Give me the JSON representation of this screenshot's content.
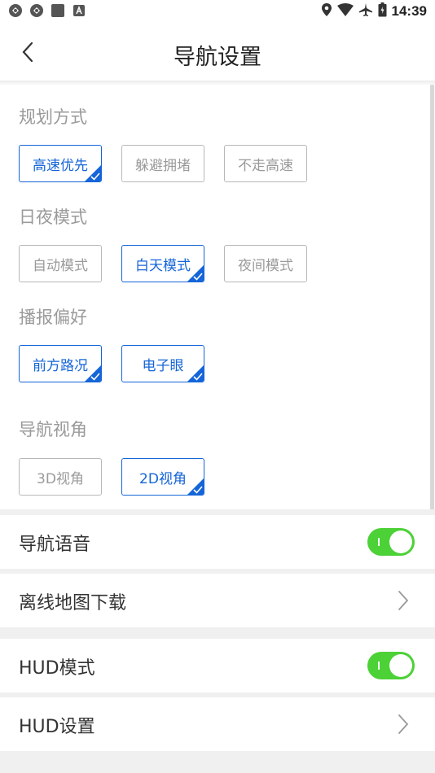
{
  "status_bar": {
    "time": "14:39",
    "left_icons": [
      "sync-icon",
      "sync-icon",
      "square-icon",
      "a-badge-icon"
    ],
    "right_icons": [
      "location-icon",
      "wifi-icon",
      "airplane-icon",
      "battery-icon"
    ]
  },
  "header": {
    "title": "导航设置"
  },
  "sections": {
    "route": {
      "title": "规划方式",
      "options": [
        "高速优先",
        "躲避拥堵",
        "不走高速"
      ],
      "selected": [
        "高速优先"
      ]
    },
    "daynight": {
      "title": "日夜模式",
      "options": [
        "自动模式",
        "白天模式",
        "夜间模式"
      ],
      "selected": [
        "白天模式"
      ]
    },
    "broadcast": {
      "title": "播报偏好",
      "options": [
        "前方路况",
        "电子眼"
      ],
      "selected": [
        "前方路况",
        "电子眼"
      ]
    },
    "view": {
      "title": "导航视角",
      "options": [
        "3D视角",
        "2D视角"
      ],
      "selected": [
        "2D视角"
      ]
    }
  },
  "rows": {
    "voice": {
      "label": "导航语音",
      "on": true
    },
    "offline_map": {
      "label": "离线地图下载"
    },
    "hud_mode": {
      "label": "HUD模式",
      "on": true
    },
    "hud_settings": {
      "label": "HUD设置"
    }
  },
  "colors": {
    "accent": "#1565d8",
    "toggle_on": "#4cd137",
    "muted_text": "#9a9a9a",
    "divider": "#f0f0f0"
  }
}
